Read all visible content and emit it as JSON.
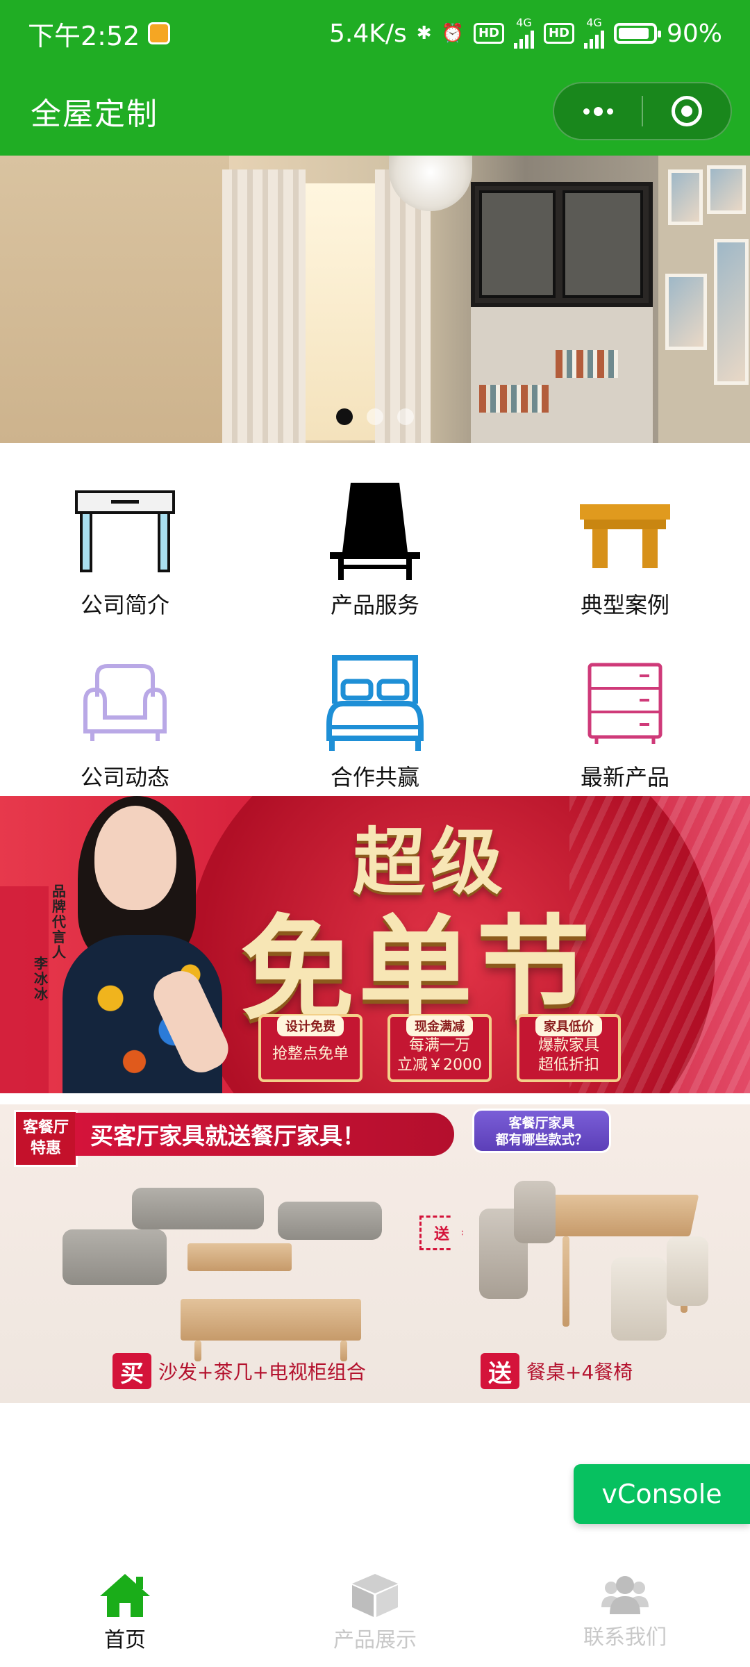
{
  "status_bar": {
    "time": "下午2:52",
    "net_speed": "5.4K/s",
    "net_type_1": "4G",
    "net_type_2": "4G",
    "battery_percent": "90%",
    "battery_level": 0.9
  },
  "nav": {
    "title": "全屋定制"
  },
  "carousel": {
    "slide_count": 3,
    "active_index": 0
  },
  "menu": {
    "items": [
      {
        "label": "公司简介",
        "icon": "desk-icon"
      },
      {
        "label": "产品服务",
        "icon": "chair-icon"
      },
      {
        "label": "典型案例",
        "icon": "stool-icon"
      },
      {
        "label": "公司动态",
        "icon": "armchair-icon"
      },
      {
        "label": "合作共赢",
        "icon": "bed-icon"
      },
      {
        "label": "最新产品",
        "icon": "drawer-cabinet-icon"
      }
    ]
  },
  "promo1": {
    "endorse": "品牌代言人",
    "endorser_name": "李冰冰",
    "title_line1": "超级",
    "title_line2": "免单节",
    "cards": [
      {
        "tag": "设计免费",
        "lines": [
          "抢整点免单"
        ]
      },
      {
        "tag": "现金满减",
        "lines": [
          "每满一万",
          "立减￥2000"
        ]
      },
      {
        "tag": "家具低价",
        "lines": [
          "爆款家具",
          "超低折扣"
        ]
      }
    ]
  },
  "promo2": {
    "badge_line1": "客餐厅",
    "badge_line2": "特惠",
    "headline": "买客厅家具就送餐厅家具！",
    "bubble_line1": "客餐厅家具",
    "bubble_line2": "都有哪些款式？",
    "send_arrow": "送",
    "buy_box": "买",
    "buy_text": "沙发+茶几+电视柜组合",
    "gift_box": "送",
    "gift_text": "餐桌+4餐椅"
  },
  "vconsole": {
    "label": "vConsole"
  },
  "tab_bar": {
    "tabs": [
      {
        "label": "首页",
        "icon": "home-icon",
        "active": true
      },
      {
        "label": "产品展示",
        "icon": "box-icon",
        "active": false
      },
      {
        "label": "联系我们",
        "icon": "contacts-icon",
        "active": false
      }
    ]
  },
  "colors": {
    "brand_green": "#20ad24",
    "vconsole_green": "#07c160",
    "promo_red": "#d4133a",
    "inactive_tab": "#c8c8c8"
  }
}
